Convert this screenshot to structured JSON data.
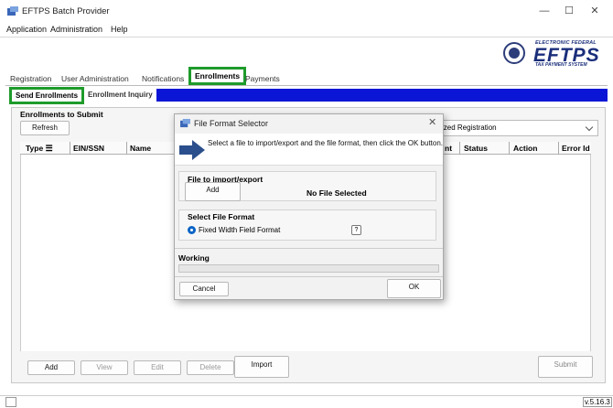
{
  "window": {
    "title": "EFTPS Batch Provider",
    "controls": {
      "minimize": "—",
      "maximize": "☐",
      "close": "✕"
    }
  },
  "menu": [
    "Application",
    "Administration",
    "Help"
  ],
  "logo": {
    "top": "ELECTRONIC FEDERAL",
    "main": "EFTPS",
    "bottom": "TAX PAYMENT SYSTEM"
  },
  "tabs": [
    "Registration",
    "User Administration",
    "Notifications",
    "Enrollments",
    "Payments"
  ],
  "active_tab": "Enrollments",
  "subtabs": [
    "Send Enrollments",
    "Enrollment Inquiry"
  ],
  "panel": {
    "title": "Enrollments to Submit",
    "refresh": "Refresh",
    "filter_value": "ized Registration",
    "columns": [
      "Type",
      "EIN/SSN",
      "Name",
      "nt",
      "Status",
      "Action",
      "Error Id"
    ],
    "buttons": {
      "add": "Add",
      "view": "View",
      "edit": "Edit",
      "delete": "Delete",
      "import": "Import",
      "submit": "Submit"
    }
  },
  "dialog": {
    "title": "File Format Selector",
    "instructions": "Select a file to import/export and the file format, then click the OK button.",
    "file_section": "File to import/export",
    "add": "Add",
    "file_status": "No File Selected",
    "format_section": "Select File Format",
    "format_option": "Fixed Width Field Format",
    "help": "?",
    "working": "Working",
    "progress": 0,
    "cancel": "Cancel",
    "ok": "OK"
  },
  "status": {
    "version": "v.5.16.3"
  },
  "colors": {
    "highlight": "#1e9b2b",
    "subbar": "#0a15d6",
    "brand": "#1a2e7a",
    "radio": "#0b64c6"
  }
}
